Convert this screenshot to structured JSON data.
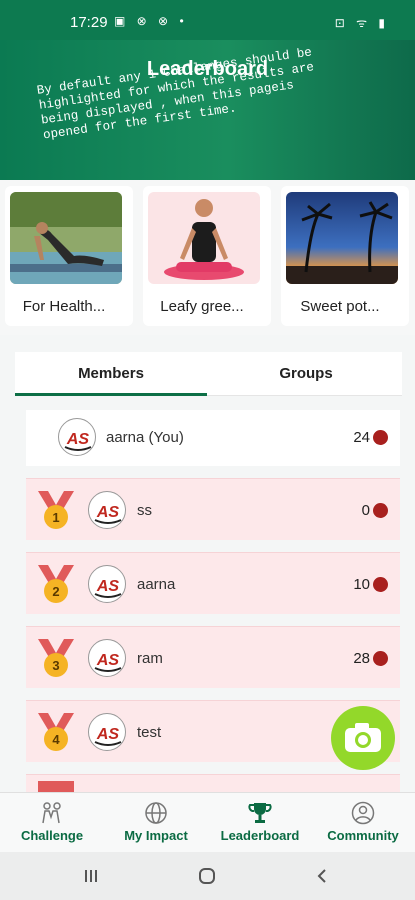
{
  "status_bar": {
    "time": "17:29",
    "left_icons": "▣ ⊗ ⊗ •",
    "right_icons": "⊡ ᯤ ▮"
  },
  "header": {
    "title": "Leaderboard",
    "note": "By default any 1 Challanges should be highlighted for which the results are being displayed , when this pageis opened for the first time."
  },
  "challenges": [
    {
      "label": "For Health..."
    },
    {
      "label": "Leafy gree..."
    },
    {
      "label": "Sweet pot..."
    }
  ],
  "tabs": [
    {
      "label": "Members",
      "active": true
    },
    {
      "label": "Groups",
      "active": false
    }
  ],
  "current_user": {
    "avatar_text": "AS",
    "name": "aarna (You)",
    "score": "24"
  },
  "leaderboard": [
    {
      "rank": "1",
      "avatar_text": "AS",
      "name": "ss",
      "score": "0"
    },
    {
      "rank": "2",
      "avatar_text": "AS",
      "name": "aarna",
      "score": "10"
    },
    {
      "rank": "3",
      "avatar_text": "AS",
      "name": "ram",
      "score": "28"
    },
    {
      "rank": "4",
      "avatar_text": "AS",
      "name": "test",
      "score": ""
    }
  ],
  "bottom_nav": [
    {
      "label": "Challenge",
      "icon": "people-icon"
    },
    {
      "label": "My Impact",
      "icon": "globe-icon"
    },
    {
      "label": "Leaderboard",
      "icon": "trophy-icon"
    },
    {
      "label": "Community",
      "icon": "user-circle-icon"
    }
  ],
  "colors": {
    "primary": "#0d7a50",
    "row_highlight": "#fde8ea",
    "fab": "#93d82a",
    "medal_ribbon": "#e05a5a",
    "medal_gold": "#f5b324"
  }
}
